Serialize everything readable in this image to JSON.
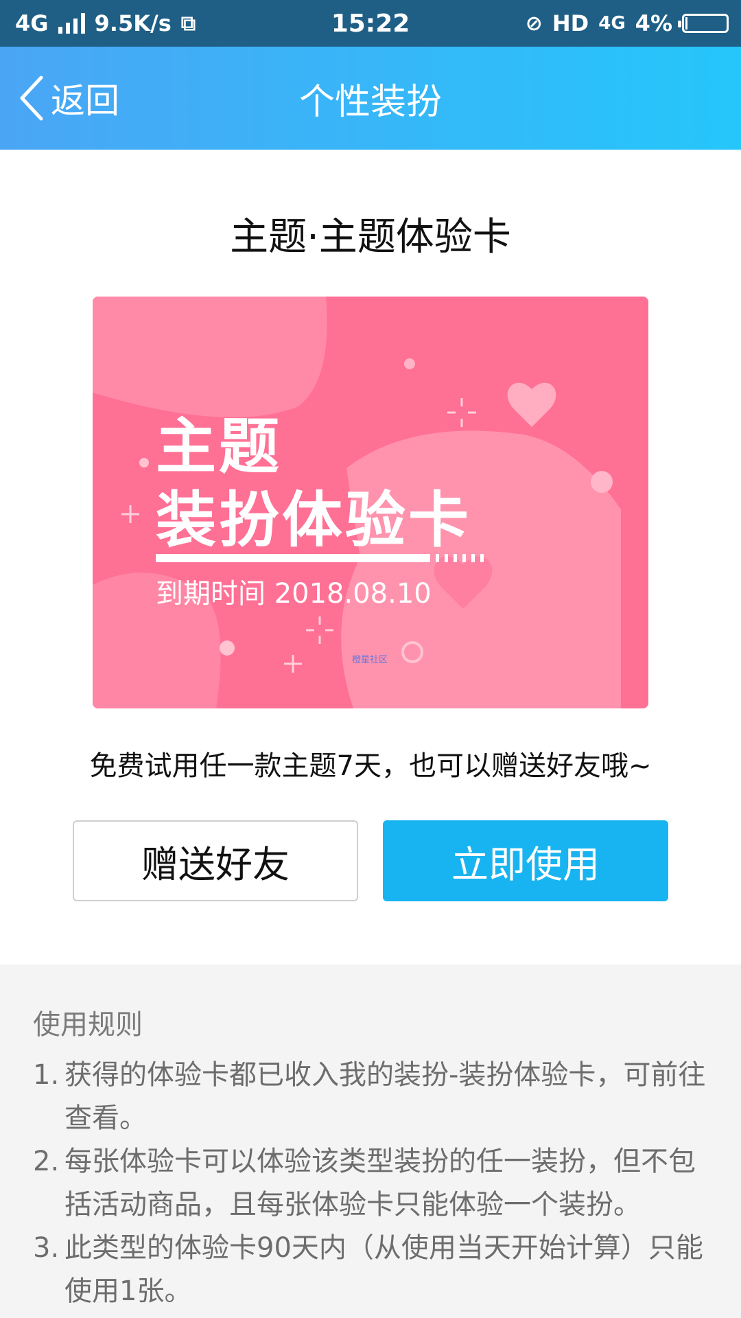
{
  "status_bar": {
    "network": "4G",
    "speed": "9.5K/s",
    "time": "15:22",
    "hd": "HD",
    "network_right": "4G",
    "battery": "4%"
  },
  "nav": {
    "back_label": "返回",
    "title": "个性装扮"
  },
  "card": {
    "title": "主题·主题体验卡",
    "line1": "主题",
    "line2": "装扮体验卡",
    "expiry": "到期时间 2018.08.10",
    "watermark": "橙星社区"
  },
  "description": "免费试用任一款主题7天，也可以赠送好友哦~",
  "buttons": {
    "gift": "赠送好友",
    "use": "立即使用"
  },
  "rules": {
    "title": "使用规则",
    "items": [
      {
        "num": "1.",
        "text": "获得的体验卡都已收入我的装扮-装扮体验卡，可前往查看。"
      },
      {
        "num": "2.",
        "text": "每张体验卡可以体验该类型装扮的任一装扮，但不包括活动商品，且每张体验卡只能体验一个装扮。"
      },
      {
        "num": "3.",
        "text": "此类型的体验卡90天内（从使用当天开始计算）只能使用1张。"
      }
    ]
  },
  "colors": {
    "status_bar": "#1f5f86",
    "nav_gradient_start": "#4aa6f5",
    "nav_gradient_end": "#25c6fb",
    "card_pink": "#ff7196",
    "primary_button": "#18b4f1",
    "rules_bg": "#f4f4f4"
  }
}
